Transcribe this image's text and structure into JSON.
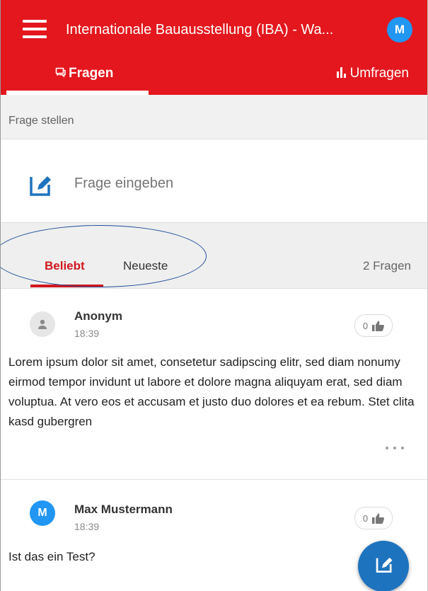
{
  "appbar": {
    "title": "Internationale Bauausstellung (IBA) - Wa...",
    "avatar_initial": "M",
    "menu_icon": "hamburger-menu-icon",
    "bg_color": "#e3171d"
  },
  "tabs": [
    {
      "label": "Fragen",
      "icon": "chat-bubbles-icon",
      "active": true
    },
    {
      "label": "Umfragen",
      "icon": "bar-chart-icon",
      "active": false
    }
  ],
  "ask": {
    "header": "Frage stellen",
    "placeholder": "Frage eingeben",
    "icon": "edit-square-icon"
  },
  "sort": {
    "options": [
      "Beliebt",
      "Neueste"
    ],
    "active": "Beliebt",
    "count_label": "2 Fragen",
    "accent_color": "#d0171d"
  },
  "questions": [
    {
      "author": "Anonym",
      "time": "18:39",
      "likes": "0",
      "avatar": "person-icon",
      "text": "Lorem ipsum dolor sit amet, consetetur sadipscing elitr, sed diam nonumy eirmod tempor invidunt ut labore et dolore magna aliquyam erat, sed diam voluptua. At vero eos et accusam et justo duo dolores et ea rebum. Stet clita kasd gubergren"
    },
    {
      "author": "Max Mustermann",
      "time": "18:39",
      "likes": "0",
      "avatar_initial": "M",
      "text": "Ist das ein Test?"
    }
  ],
  "fab": {
    "icon": "edit-square-icon",
    "color": "#1e73be"
  }
}
